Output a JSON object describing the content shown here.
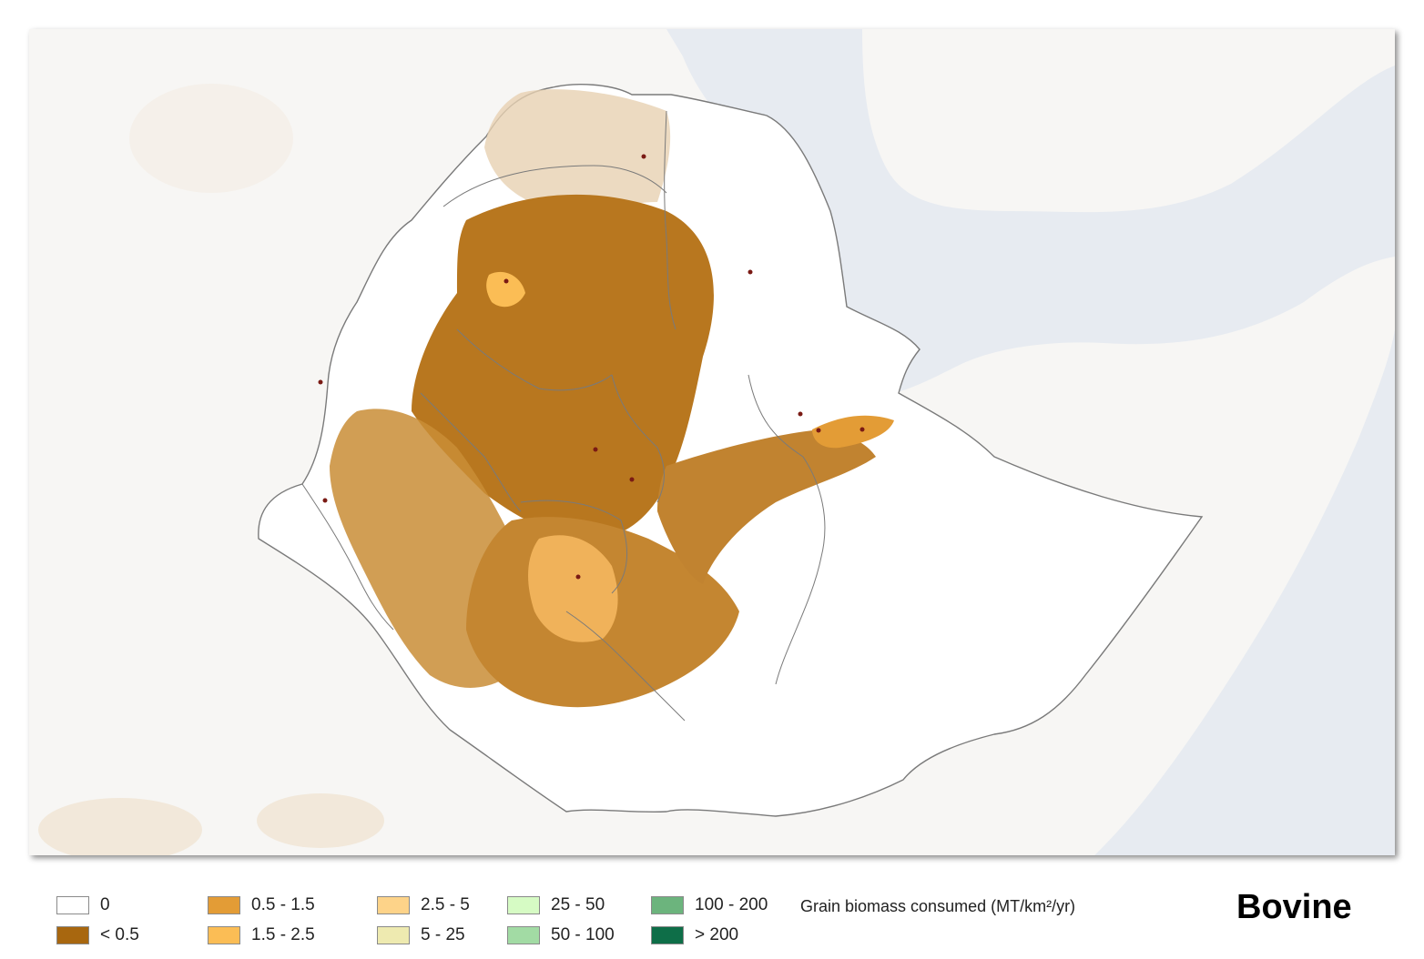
{
  "map": {
    "title": "Bovine",
    "legend_title": "Grain biomass consumed (MT/km²/yr)",
    "legend": [
      {
        "label": "0",
        "color": "#ffffff"
      },
      {
        "label": "< 0.5",
        "color": "#a8670f"
      },
      {
        "label": "0.5 - 1.5",
        "color": "#e39c36"
      },
      {
        "label": "1.5 - 2.5",
        "color": "#fbbd55"
      },
      {
        "label": "2.5 - 5",
        "color": "#fdd389"
      },
      {
        "label": "5 - 25",
        "color": "#eeeab0"
      },
      {
        "label": "25 - 50",
        "color": "#d6fbc4"
      },
      {
        "label": "50 - 100",
        "color": "#a2dba4"
      },
      {
        "label": "100 - 200",
        "color": "#6cb47d"
      },
      {
        "label": "> 200",
        "color": "#0e6e48"
      }
    ],
    "colors": {
      "background_land": "#f7f6f4",
      "water": "#e7ebf1",
      "country_fill": "#ffffff",
      "border": "#7a7a7a",
      "city_marker": "#7a1a14",
      "outside_density": "#efe3cf"
    }
  }
}
